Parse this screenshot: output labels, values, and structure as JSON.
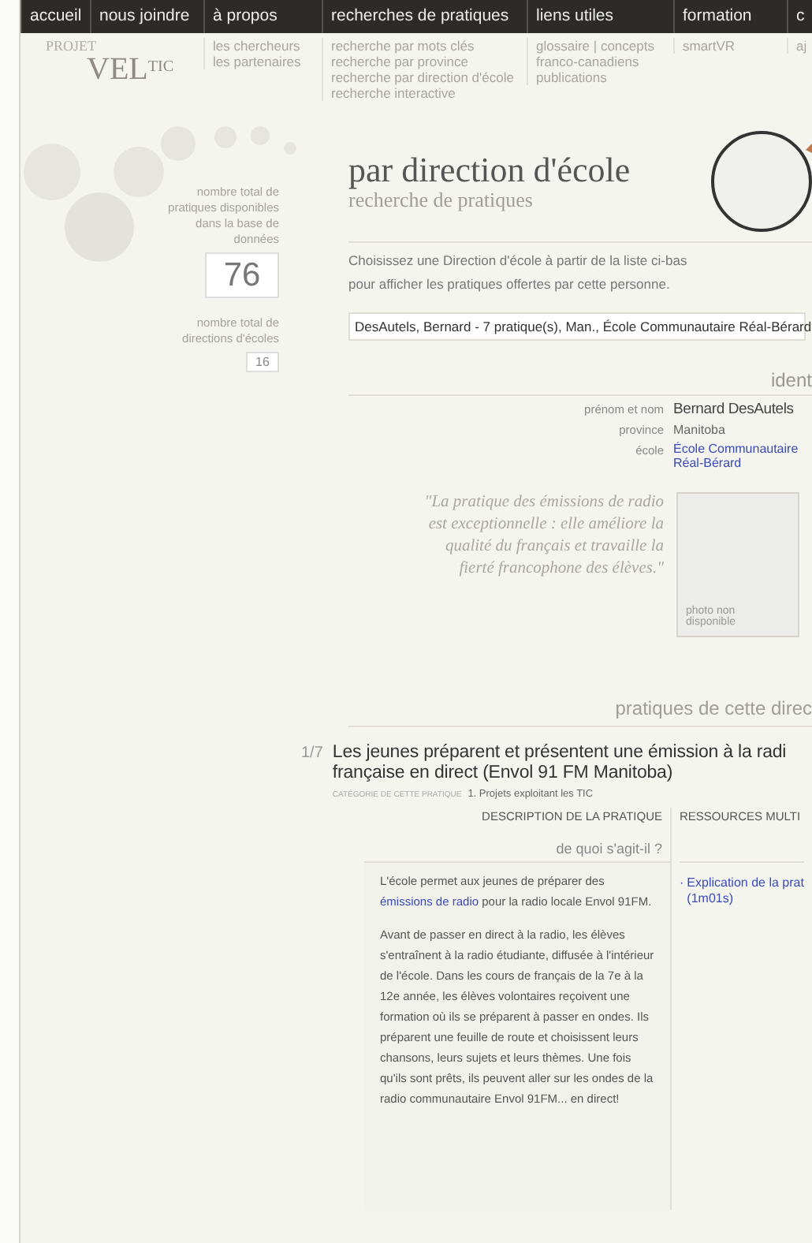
{
  "nav": [
    {
      "label": "accueil"
    },
    {
      "label": "nous joindre"
    },
    {
      "label": "à propos",
      "submenu": [
        "les chercheurs",
        "les partenaires"
      ]
    },
    {
      "label": "recherches de pratiques",
      "submenu": [
        "recherche par mots clés",
        "recherche par province",
        "recherche par direction d'école",
        "recherche interactive"
      ]
    },
    {
      "label": "liens utiles",
      "submenu": [
        "glossaire | concepts franco-canadiens",
        "publications"
      ]
    },
    {
      "label": "formation",
      "submenu": [
        "smartVR"
      ]
    },
    {
      "label": "c",
      "submenu": [
        "aj"
      ]
    }
  ],
  "logo": {
    "top": "PROJET",
    "main": "VEL",
    "sup": "TIC"
  },
  "stats": [
    {
      "label": "nombre total de pratiques disponibles dans la base de données",
      "value": "76",
      "kind": "large"
    },
    {
      "label": "nombre total de directions d'écoles",
      "value": "16",
      "kind": "small"
    }
  ],
  "title": "par direction d'école",
  "subtitle": "recherche de pratiques",
  "intro": "Choisissez une Direction d'école à partir de la liste ci-bas pour afficher les pratiques offertes par cette personne.",
  "select": {
    "value": "DesAutels, Bernard - 7 pratique(s), Man., École Communautaire Réal-Bérard"
  },
  "identity": {
    "heading": "ident",
    "rows": [
      {
        "label": "prénom et nom",
        "value": "Bernard DesAutels",
        "kind": "name"
      },
      {
        "label": "province",
        "value": "Manitoba",
        "kind": "text"
      },
      {
        "label": "école",
        "value": "École Communautaire Réal-Bérard",
        "kind": "link"
      }
    ],
    "quote": "\"La pratique des émissions de radio est exceptionnelle : elle améliore la qualité du français et travaille la fierté francophone des élèves.\"",
    "photo": "photo non disponible"
  },
  "practices_heading": "pratiques de cette direc",
  "practice": {
    "index": "1/7",
    "title_lines": [
      "Les jeunes préparent et présentent une émission à la radi",
      "française en direct (Envol 91 FM Manitoba)"
    ],
    "category_label": "CATÉGORIE DE CETTE PRATIQUE",
    "category": "1. Projets exploitant les TIC",
    "description_heading": "DESCRIPTION DE LA PRATIQUE",
    "resources_heading": "RESSOURCES MULTI",
    "question": "de quoi s'agit-il ?",
    "paragraphs": [
      [
        {
          "kind": "text",
          "text": "L'école permet aux jeunes de préparer des "
        },
        {
          "kind": "link",
          "text": "émissions de radio"
        },
        {
          "kind": "text",
          "text": " pour la radio locale Envol 91FM."
        }
      ],
      [
        {
          "kind": "text",
          "text": "Avant de passer en direct à la radio, les élèves s'entraînent à la radio étudiante, diffusée à l'intérieur de l'école. Dans les cours de français de la 7e à la 12e année, les élèves volontaires reçoivent une formation où ils se préparent à passer en ondes. Ils préparent une feuille de route et choisissent leurs chansons, leurs sujets et leurs thèmes. Une fois qu'ils sont prêts, ils peuvent aller sur les ondes de la radio communautaire Envol 91FM... en direct!"
        }
      ]
    ],
    "resources": [
      {
        "bullet": "·",
        "lines": [
          "Explication de la prat",
          "(1m01s)"
        ]
      }
    ]
  }
}
